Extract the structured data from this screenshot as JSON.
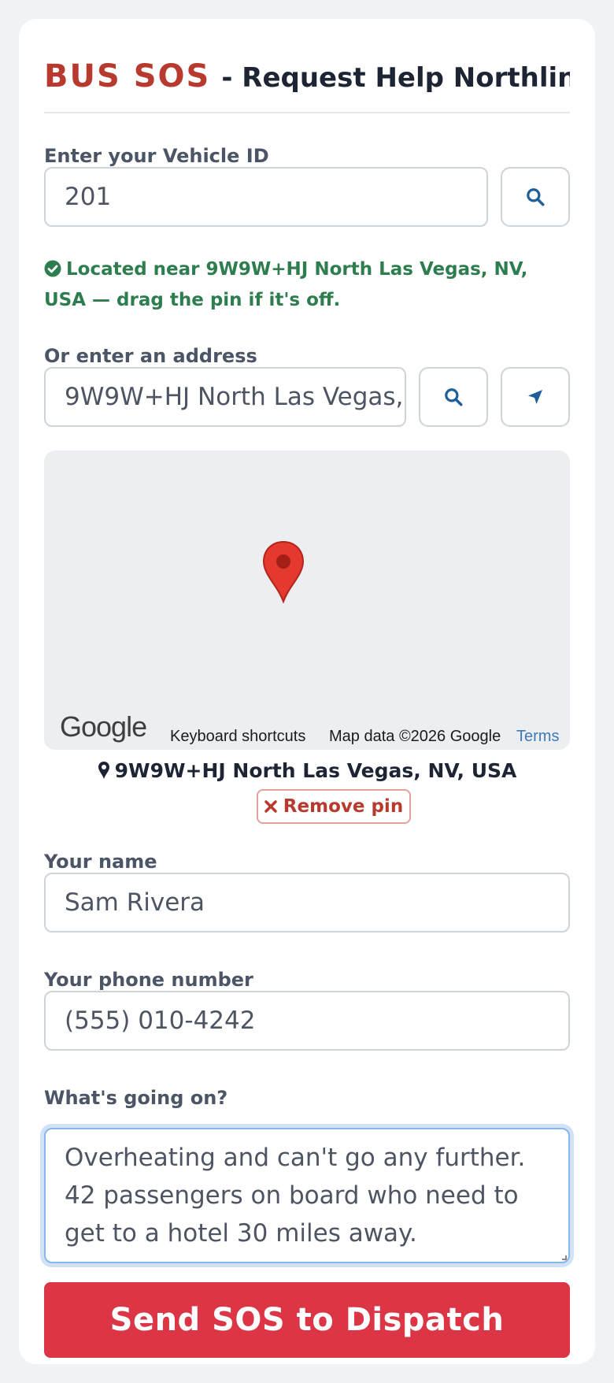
{
  "header": {
    "brand": "BUS SOS",
    "title": "- Request Help Northline ..."
  },
  "vehicle": {
    "label": "Enter your Vehicle ID",
    "value": "201",
    "search_icon": "search-icon"
  },
  "status": {
    "message": "Located near 9W9W+HJ North Las Vegas, NV, USA — drag the pin if it's off.",
    "color": "#2e7d4f"
  },
  "address": {
    "label": "Or enter an address",
    "value": "9W9W+HJ North Las Vegas,",
    "search_icon": "search-icon",
    "locate_icon": "location-arrow-icon"
  },
  "map": {
    "logo": "Google",
    "keyboard_shortcuts": "Keyboard shortcuts",
    "map_data": "Map data ©2026 Google",
    "terms": "Terms"
  },
  "pin": {
    "address": "9W9W+HJ North Las Vegas, NV, USA",
    "remove_label": "Remove pin"
  },
  "name": {
    "label": "Your name",
    "value": "Sam Rivera"
  },
  "phone": {
    "label": "Your phone number",
    "value": "(555) 010-4242"
  },
  "issue": {
    "label": "What's going on?",
    "value": "Overheating and can't go any further. 42 passengers on board who need to get to a hotel 30 miles away."
  },
  "submit": {
    "label": "Send SOS to Dispatch",
    "color": "#dc3545"
  },
  "colors": {
    "brand": "#b83a2f",
    "accent": "#1f5f99"
  }
}
